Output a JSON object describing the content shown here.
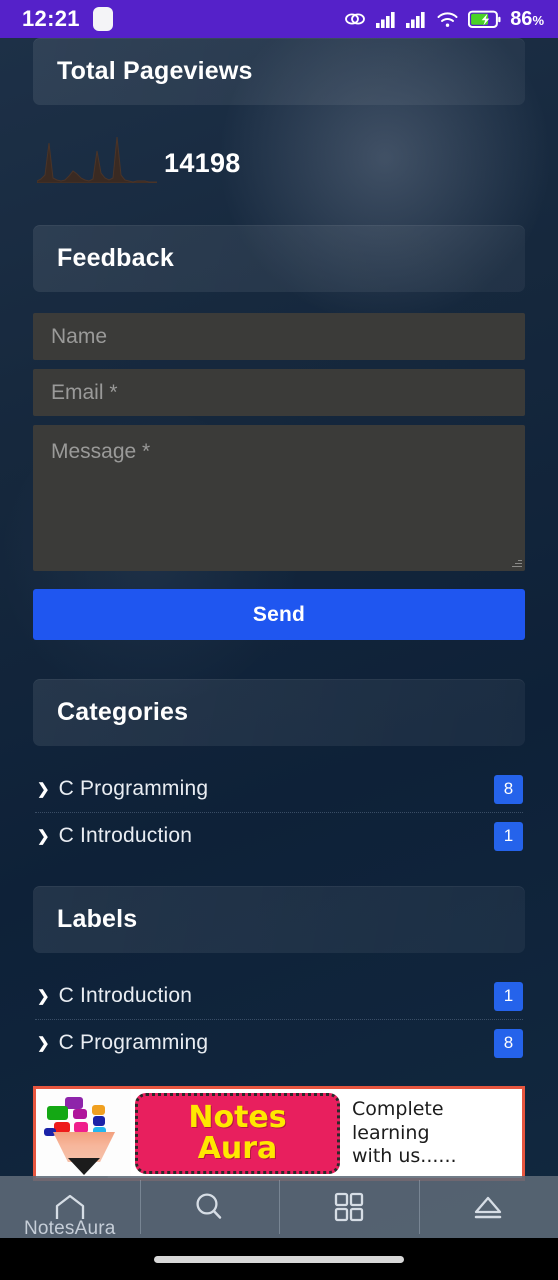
{
  "status_bar": {
    "time": "12:21",
    "battery_percent": "86",
    "percent_symbol": "%",
    "icons": [
      "app-square-icon",
      "link-icon",
      "signal-bars-icon",
      "signal-bars-icon",
      "wifi-icon",
      "battery-charging-icon"
    ],
    "background_color": "#5521c9",
    "battery_fill_color": "#4ad326"
  },
  "pageviews": {
    "header": "Total Pageviews",
    "count": "14198",
    "sparkline_color": "#3a2a22"
  },
  "chart_data": {
    "type": "area",
    "title": "Total Pageviews",
    "x": [
      1,
      2,
      3,
      4,
      5,
      6,
      7,
      8,
      9,
      10,
      11,
      12,
      13,
      14,
      15,
      16,
      17,
      18,
      19,
      20,
      21,
      22,
      23,
      24,
      25,
      26,
      27,
      28,
      29,
      30
    ],
    "values": [
      3,
      6,
      34,
      10,
      5,
      4,
      3,
      4,
      9,
      14,
      11,
      6,
      4,
      3,
      5,
      26,
      12,
      6,
      4,
      6,
      38,
      9,
      4,
      3,
      2,
      3,
      3,
      3,
      2,
      2
    ],
    "total": 14198,
    "xlabel": "",
    "ylabel": "",
    "grid": false,
    "legend": false
  },
  "feedback": {
    "header": "Feedback",
    "name_placeholder": "Name",
    "email_placeholder": "Email *",
    "message_placeholder": "Message *",
    "send_label": "Send",
    "send_color": "#1f56f0"
  },
  "categories": {
    "header": "Categories",
    "items": [
      {
        "label": "C Programming",
        "count": "8"
      },
      {
        "label": "C Introduction",
        "count": "1"
      }
    ]
  },
  "labels": {
    "header": "Labels",
    "items": [
      {
        "label": "C Introduction",
        "count": "1"
      },
      {
        "label": "C Programming",
        "count": "8"
      }
    ]
  },
  "banner": {
    "title_line1": "Notes",
    "title_line2": "Aura",
    "tagline_line1": "Complete learning",
    "tagline_line2": "with us......",
    "border_color": "#e8563f",
    "title_bg_color": "#e81f5e",
    "title_text_color": "#ffe800"
  },
  "bottom_nav": {
    "items": [
      {
        "icon": "home-icon",
        "label": "NotesAura"
      },
      {
        "icon": "search-icon",
        "label": ""
      },
      {
        "icon": "grid-icon",
        "label": ""
      },
      {
        "icon": "eject-icon",
        "label": ""
      }
    ]
  },
  "badge_color": "#2563eb"
}
